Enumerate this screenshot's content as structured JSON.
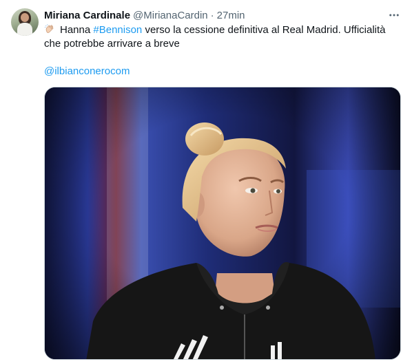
{
  "tweet": {
    "author": {
      "display_name": "Miriana Cardinale",
      "handle": "@MirianaCardin",
      "separator": "·",
      "timestamp": "27min"
    },
    "text": {
      "emoji": "clapping-hands-emoji",
      "prefix": "Hanna",
      "hashtag": "#Bennison",
      "body": "verso la cessione definitiva al Real Madrid. Ufficialità che potrebbe arrivare a breve",
      "mention": "@ilbianconerocom"
    },
    "more_icon": "more-horizontal-icon",
    "media": {
      "description_icon": "photo",
      "colors": {
        "background_dark": "#0b0c1e",
        "stadium_blue": "#1f3a8f",
        "stadium_red": "#7a1e2c",
        "hoodie": "#141414",
        "skin": "#e2b398",
        "hair": "#e7c48f"
      }
    },
    "colors": {
      "link": "#1d9bf0",
      "secondary_text": "#536471",
      "primary_text": "#0f1419"
    }
  }
}
